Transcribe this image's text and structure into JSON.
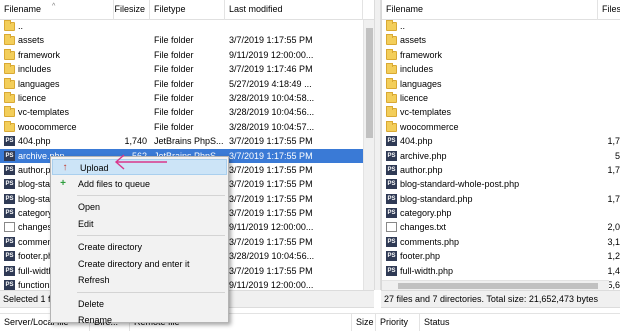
{
  "colors": {
    "selection": "#3a7ad6",
    "menu_highlight": "#cce4f7",
    "annotation": "#d9368c"
  },
  "local": {
    "headers": {
      "filename": "Filename",
      "filesize": "Filesize",
      "filetype": "Filetype",
      "modified": "Last modified"
    },
    "rows": [
      {
        "icon": "folder-up-icon",
        "name": "..",
        "size": "",
        "type": "",
        "modified": ""
      },
      {
        "icon": "folder-icon",
        "name": "assets",
        "size": "",
        "type": "File folder",
        "modified": "3/7/2019 1:17:55 PM"
      },
      {
        "icon": "folder-icon",
        "name": "framework",
        "size": "",
        "type": "File folder",
        "modified": "9/11/2019 12:00:00..."
      },
      {
        "icon": "folder-icon",
        "name": "includes",
        "size": "",
        "type": "File folder",
        "modified": "3/7/2019 1:17:46 PM"
      },
      {
        "icon": "folder-icon",
        "name": "languages",
        "size": "",
        "type": "File folder",
        "modified": "5/27/2019 4:18:49 ..."
      },
      {
        "icon": "folder-icon",
        "name": "licence",
        "size": "",
        "type": "File folder",
        "modified": "3/28/2019 10:04:58..."
      },
      {
        "icon": "folder-icon",
        "name": "vc-templates",
        "size": "",
        "type": "File folder",
        "modified": "3/28/2019 10:04:56..."
      },
      {
        "icon": "folder-icon",
        "name": "woocommerce",
        "size": "",
        "type": "File folder",
        "modified": "3/28/2019 10:04:57..."
      },
      {
        "icon": "php-file-icon",
        "name": "404.php",
        "size": "1,740",
        "type": "JetBrains PhpS...",
        "modified": "3/7/2019 1:17:55 PM"
      },
      {
        "icon": "php-file-icon",
        "name": "archive.php",
        "size": "562",
        "type": "JetBrains PhpS...",
        "modified": "3/7/2019 1:17:55 PM"
      },
      {
        "icon": "php-file-icon",
        "name": "author.php",
        "size": "",
        "type": "",
        "modified": "3/7/2019 1:17:55 PM"
      },
      {
        "icon": "php-file-icon",
        "name": "blog-standard-whole-post.php",
        "size": "",
        "type": "",
        "modified": "3/7/2019 1:17:55 PM"
      },
      {
        "icon": "php-file-icon",
        "name": "blog-standard.php",
        "size": "",
        "type": "",
        "modified": "3/7/2019 1:17:55 PM"
      },
      {
        "icon": "php-file-icon",
        "name": "category.php",
        "size": "",
        "type": "",
        "modified": "3/7/2019 1:17:55 PM"
      },
      {
        "icon": "text-file-icon",
        "name": "changes.txt",
        "size": "",
        "type": "",
        "modified": "9/11/2019 12:00:00..."
      },
      {
        "icon": "php-file-icon",
        "name": "comments.php",
        "size": "",
        "type": "",
        "modified": "3/7/2019 1:17:55 PM"
      },
      {
        "icon": "php-file-icon",
        "name": "footer.php",
        "size": "",
        "type": "",
        "modified": "3/28/2019 10:04:56..."
      },
      {
        "icon": "php-file-icon",
        "name": "full-width.php",
        "size": "",
        "type": "",
        "modified": "3/7/2019 1:17:55 PM"
      },
      {
        "icon": "php-file-icon",
        "name": "functions.php",
        "size": "",
        "type": "",
        "modified": "9/11/2019 12:00:00..."
      }
    ],
    "status": "Selected 1 file. Total size: 562 bytes"
  },
  "remote": {
    "headers": {
      "filename": "Filename",
      "filesize": "Files"
    },
    "rows": [
      {
        "icon": "folder-up-icon",
        "name": "..",
        "size": ""
      },
      {
        "icon": "folder-icon",
        "name": "assets",
        "size": ""
      },
      {
        "icon": "folder-icon",
        "name": "framework",
        "size": ""
      },
      {
        "icon": "folder-icon",
        "name": "includes",
        "size": ""
      },
      {
        "icon": "folder-icon",
        "name": "languages",
        "size": ""
      },
      {
        "icon": "folder-icon",
        "name": "licence",
        "size": ""
      },
      {
        "icon": "folder-icon",
        "name": "vc-templates",
        "size": ""
      },
      {
        "icon": "folder-icon",
        "name": "woocommerce",
        "size": ""
      },
      {
        "icon": "php-file-icon",
        "name": "404.php",
        "size": "1,7"
      },
      {
        "icon": "php-file-icon",
        "name": "archive.php",
        "size": "5"
      },
      {
        "icon": "php-file-icon",
        "name": "author.php",
        "size": "1,7"
      },
      {
        "icon": "php-file-icon",
        "name": "blog-standard-whole-post.php",
        "size": ""
      },
      {
        "icon": "php-file-icon",
        "name": "blog-standard.php",
        "size": "1,7"
      },
      {
        "icon": "php-file-icon",
        "name": "category.php",
        "size": ""
      },
      {
        "icon": "text-file-icon",
        "name": "changes.txt",
        "size": "2,0"
      },
      {
        "icon": "php-file-icon",
        "name": "comments.php",
        "size": "3,1"
      },
      {
        "icon": "php-file-icon",
        "name": "footer.php",
        "size": "1,2"
      },
      {
        "icon": "php-file-icon",
        "name": "full-width.php",
        "size": "1,4"
      },
      {
        "icon": "php-file-icon",
        "name": "functions.php",
        "size": "35,6"
      }
    ],
    "status": "27 files and 7 directories. Total size: 21,652,473 bytes"
  },
  "context_menu": {
    "items": [
      {
        "label": "Upload",
        "icon": "upload-arrow-icon",
        "highlighted": true
      },
      {
        "label": "Add files to queue",
        "icon": "add-to-queue-icon"
      },
      {
        "separator": true
      },
      {
        "label": "Open"
      },
      {
        "label": "Edit"
      },
      {
        "separator": true
      },
      {
        "label": "Create directory"
      },
      {
        "label": "Create directory and enter it"
      },
      {
        "label": "Refresh"
      },
      {
        "separator": true
      },
      {
        "label": "Delete"
      },
      {
        "label": "Rename"
      }
    ]
  },
  "queue": {
    "headers": {
      "server_local": "Server/Local file",
      "direction": "Dire...",
      "remote": "Remote file",
      "size": "Size",
      "priority": "Priority",
      "status": "Status"
    }
  }
}
